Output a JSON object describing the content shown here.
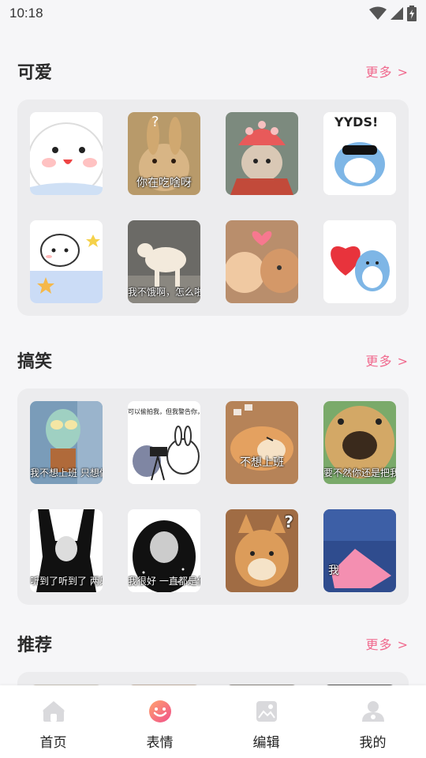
{
  "status_bar": {
    "time": "10:18"
  },
  "sections": [
    {
      "title": "可爱",
      "more": "更多 >",
      "stickers": [
        {
          "name": "white-bear-sticker",
          "caption": ""
        },
        {
          "name": "bunny-sticker",
          "caption": "你在吃啥呀"
        },
        {
          "name": "crowned-cat-sticker",
          "caption": ""
        },
        {
          "name": "yyds-dolphin-sticker",
          "caption": "YYDS!"
        },
        {
          "name": "bear-with-stars-sticker",
          "caption": ""
        },
        {
          "name": "labrador-sticker",
          "caption": "我不饿啊，怎么啦"
        },
        {
          "name": "cats-kissing-sticker",
          "caption": ""
        },
        {
          "name": "dolphin-heart-sticker",
          "caption": ""
        }
      ]
    },
    {
      "title": "搞笑",
      "more": "更多 >",
      "stickers": [
        {
          "name": "squidward-sticker",
          "caption": "我不想上班 只想做个面瘫"
        },
        {
          "name": "bunny-camera-sticker",
          "caption": "可以偷拍我，但我警告你，要用美颜相机"
        },
        {
          "name": "sleepy-shiba-sticker",
          "caption": "不想上班"
        },
        {
          "name": "dog-nose-sticker",
          "caption": "要不然你还是把我删了吧"
        },
        {
          "name": "panda-man-sticker",
          "caption": "听到了听到了 两只耳朵都听到了"
        },
        {
          "name": "panda-man-stars-sticker",
          "caption": "我很好 一直都是你被爱"
        },
        {
          "name": "shiba-question-sticker",
          "caption": "?"
        },
        {
          "name": "patrick-sticker",
          "caption": "我"
        }
      ]
    },
    {
      "title": "推荐",
      "more": "更多 >"
    }
  ],
  "bottom_nav": [
    {
      "label": "首页",
      "icon": "home-icon",
      "active": false
    },
    {
      "label": "表情",
      "icon": "emoji-icon",
      "active": true
    },
    {
      "label": "编辑",
      "icon": "edit-icon",
      "active": false
    },
    {
      "label": "我的",
      "icon": "profile-icon",
      "active": false
    }
  ],
  "colors": {
    "accent": "#f06a8e",
    "icon_inactive": "#d9d9dc",
    "background": "#f6f6f8",
    "card": "#ececee"
  }
}
